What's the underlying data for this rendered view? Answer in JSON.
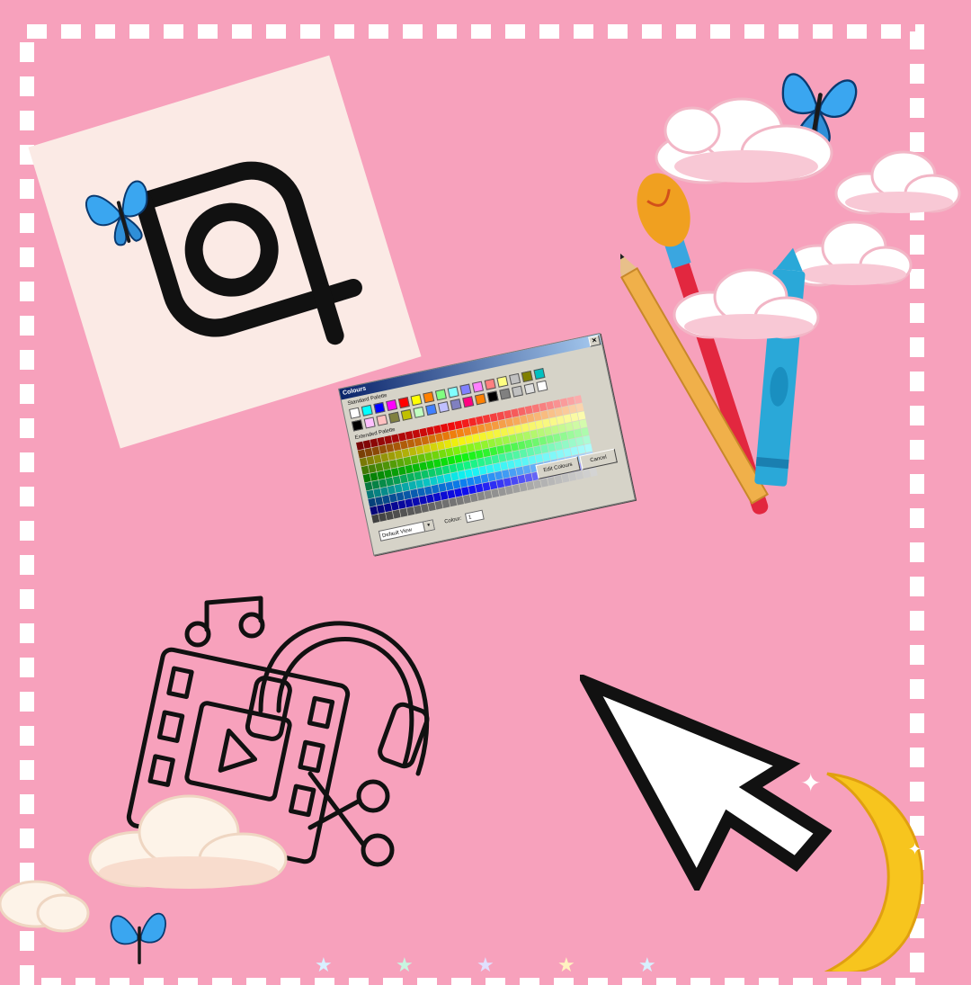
{
  "colour_dialog": {
    "title": "Colours",
    "close_glyph": "✕",
    "standard_palette_label": "Standard Palette",
    "extended_palette_label": "Extended Palette",
    "edit_colours_label": "Edit Colours",
    "cancel_label": "Cancel",
    "view_value": "Default View",
    "colour_label": "Colour:",
    "colour_value": "1",
    "standard_colors": [
      "#ffffff",
      "#00ffff",
      "#0000ff",
      "#ff00ff",
      "#ff0000",
      "#ffff00",
      "#ff8000",
      "#80ff80",
      "#80ffff",
      "#8080ff",
      "#ff80ff",
      "#ff8080",
      "#ffff80",
      "#c0c0c0",
      "#808000",
      "#00c0c0",
      "#000000",
      "#ffc0ff",
      "#ffc0c0",
      "#808040",
      "#c0c000",
      "#c0ffc0",
      "#4080ff",
      "#c0c0ff",
      "#8080c0",
      "#ff0080",
      "#ff8000",
      "#000000",
      "#808080",
      "#c0c0c0",
      "#e0e0e0",
      "#ffffff"
    ]
  },
  "stickers": {
    "crop_app_icon": "crop-app-icon",
    "butterflies": "butterfly-icon",
    "art_tools": "paintbrush-pencil-crayon",
    "video_editor": "video-music-editing-icon",
    "cursor": "pixel-cursor-icon",
    "moon": "crescent-moon",
    "clouds": "pixel-cloud"
  },
  "colors": {
    "background": "#f7a1bc",
    "frame": "#ffffff",
    "icon_card": "#fbeae5",
    "butterfly": "#3aa6f0"
  }
}
